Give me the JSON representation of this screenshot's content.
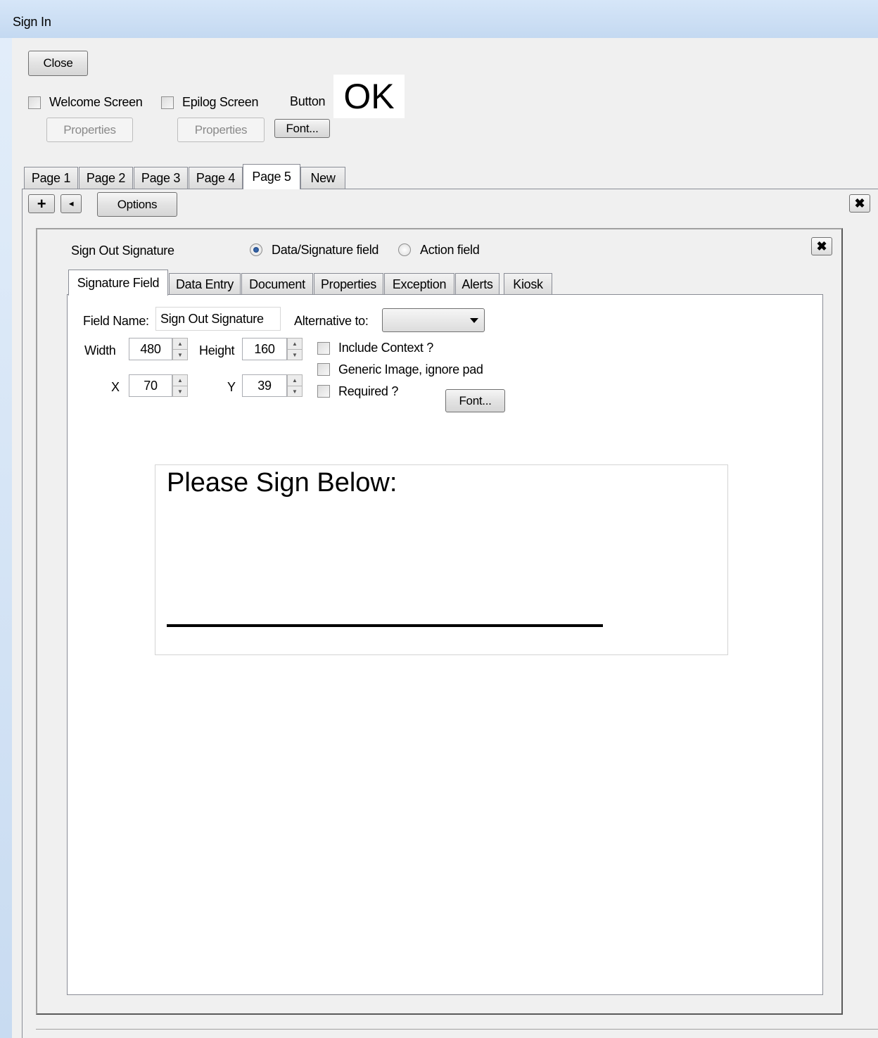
{
  "window": {
    "title": "Sign In"
  },
  "toolbar": {
    "close_label": "Close",
    "welcome_screen_label": "Welcome Screen",
    "epilog_screen_label": "Epilog Screen",
    "properties_label_1": "Properties",
    "properties_label_2": "Properties",
    "button_label": "Button",
    "button_preview": "OK",
    "font_label": "Font..."
  },
  "page_tabs": [
    "Page 1",
    "Page 2",
    "Page 3",
    "Page 4",
    "Page 5",
    "New"
  ],
  "page_toolbar": {
    "add_glyph": "+",
    "back_glyph": "◄",
    "options_label": "Options",
    "close_glyph": "✖"
  },
  "field_header": {
    "name": "Sign Out Signature",
    "radio_data_label": "Data/Signature field",
    "radio_action_label": "Action field",
    "close_glyph": "✖"
  },
  "inner_tabs": [
    "Signature Field",
    "Data Entry",
    "Document",
    "Properties",
    "Exception",
    "Alerts",
    "Kiosk"
  ],
  "form": {
    "field_name_label": "Field Name:",
    "field_name_value": "Sign Out Signature",
    "alternative_label": "Alternative to:",
    "alternative_value": "",
    "width_label": "Width",
    "width_value": "480",
    "height_label": "Height",
    "height_value": "160",
    "x_label": "X",
    "x_value": "70",
    "y_label": "Y",
    "y_value": "39",
    "include_context_label": "Include Context ?",
    "generic_image_label": "Generic Image, ignore pad",
    "required_label": "Required ?",
    "font_label": "Font..."
  },
  "preview": {
    "prompt": "Please Sign Below:"
  },
  "colors": {
    "active_radio": "#1b3f78",
    "title_bar": "#c4d9f1"
  }
}
